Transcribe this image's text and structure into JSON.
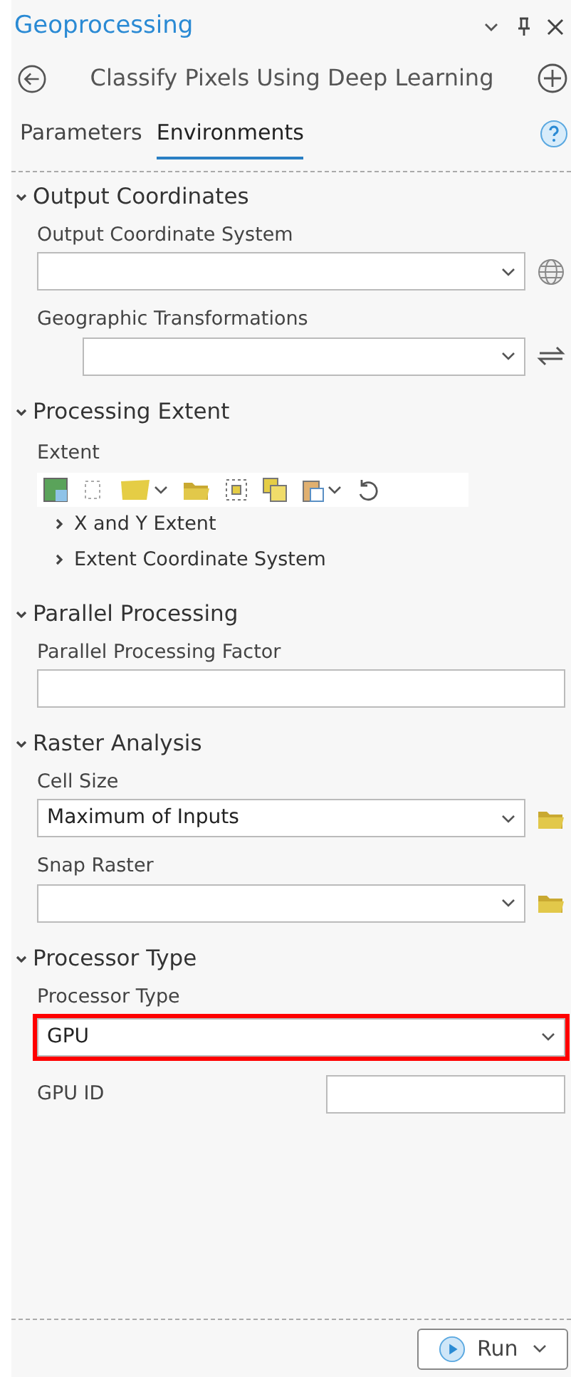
{
  "pane": {
    "title": "Geoprocessing"
  },
  "tool": {
    "title": "Classify Pixels Using Deep Learning"
  },
  "tabs": [
    {
      "label": "Parameters",
      "selected": false
    },
    {
      "label": "Environments",
      "selected": true
    }
  ],
  "sections": [
    {
      "title": "Output Coordinates",
      "expanded": true,
      "items": [
        {
          "kind": "coordinate-dropdown",
          "label": "Output Coordinate System"
        },
        {
          "kind": "transform-dropdown",
          "label": "Geographic Transformations"
        }
      ]
    },
    {
      "title": "Processing Extent",
      "expanded": true,
      "items": [
        {
          "kind": "extent",
          "label": "Extent",
          "children": [
            {
              "label": "X and Y Extent",
              "expanded": false
            },
            {
              "label": "Extent Coordinate System",
              "expanded": false
            }
          ]
        }
      ]
    },
    {
      "title": "Parallel Processing",
      "expanded": true,
      "items": [
        {
          "kind": "text",
          "label": "Parallel Processing Factor"
        }
      ]
    },
    {
      "title": "Raster Analysis",
      "expanded": true,
      "items": [
        {
          "kind": "browse-dropdown",
          "label": "Cell Size",
          "value": "Maximum of Inputs"
        },
        {
          "kind": "browse-dropdown",
          "label": "Snap Raster"
        }
      ]
    },
    {
      "title": "Processor Type",
      "expanded": true,
      "items": [
        {
          "kind": "dropdown",
          "label": "Processor Type",
          "value": "GPU",
          "highlighted": true
        },
        {
          "kind": "inline-text",
          "label": "GPU ID"
        }
      ]
    }
  ],
  "run_button": {
    "label": "Run"
  }
}
